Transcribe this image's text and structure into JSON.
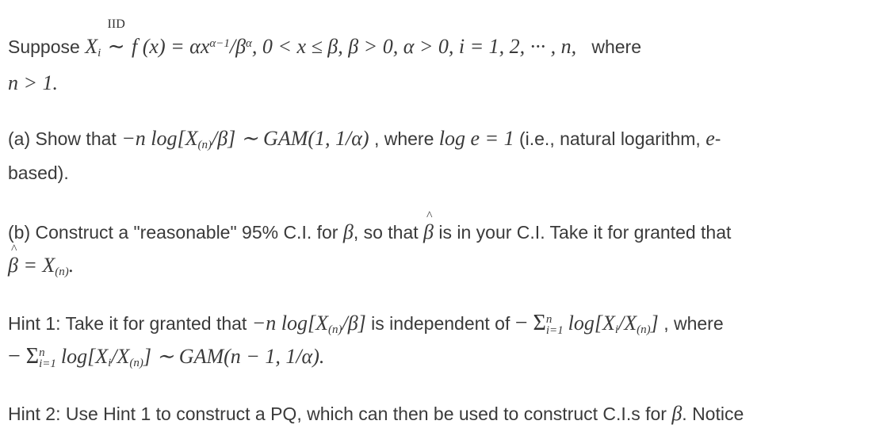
{
  "problem": {
    "intro": {
      "prefix": "Suppose",
      "iid_label": "IID",
      "condition_text": "f (x) = αx",
      "exponent": "α−1",
      "density_rest": "/β",
      "density_exp": "α",
      "constraints": ", 0 < x ≤ β,  β > 0,  α > 0, i = 1, 2, ··· , n,",
      "suffix": "where",
      "line2": "n > 1."
    },
    "part_a": {
      "label": "(a) Show that",
      "expr_lead": "−n log[X",
      "sub_n": "(n)",
      "expr_tail": "/β] ∼ GAM(1, 1/α)",
      "mid": ", where",
      "log_expr": "log e = 1",
      "note": "(i.e., natural logarithm,",
      "e_char": "e",
      "dash": "-",
      "line2": "based)."
    },
    "part_b": {
      "text1": "(b) Construct a \"reasonable\" 95% C.I. for",
      "beta": "β",
      "text2": ", so that",
      "text3": "is in your C.I. Take it for granted that",
      "line2_eq": "= X",
      "sub_n": "(n)",
      "line2_end": "."
    },
    "hint1": {
      "text1": "Hint 1: Take it for granted that",
      "expr_lead": "−n log[X",
      "sub_n": "(n)",
      "expr_tail": "/β]",
      "text2": "is independent of",
      "sum_expr": "− Σ",
      "sum_sup": "n",
      "sum_sub": "i=1",
      "log_part": "log[X",
      "sub_i": "i",
      "div": "/X",
      "close": "]",
      "text3": ", where",
      "line2_tail": "] ∼ GAM(n − 1, 1/α)."
    },
    "hint2": {
      "text": "Hint 2: Use Hint 1 to construct a PQ, which can then be used to construct C.I.s for",
      "beta": "β",
      "end": ". Notice"
    }
  }
}
